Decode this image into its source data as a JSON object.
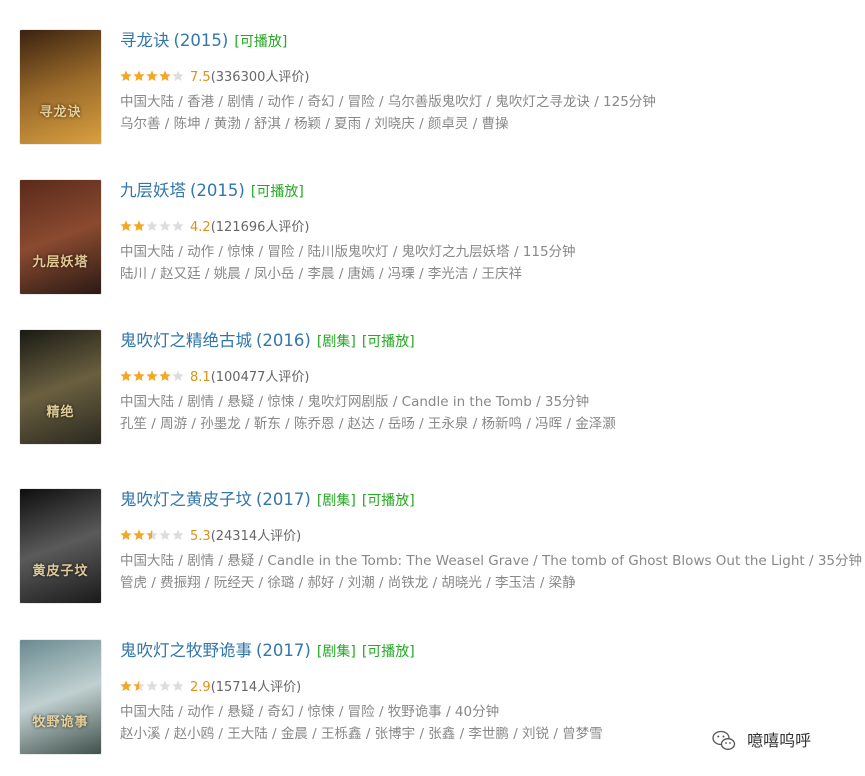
{
  "films": [
    {
      "title": "寻龙诀",
      "year": "(2015)",
      "tags": [
        "[可播放]"
      ],
      "rating_stars": 4,
      "rating": "7.5",
      "votes": "(336300人评价)",
      "meta1": "中国大陆 / 香港 / 剧情 / 动作 / 奇幻 / 冒险 / 乌尔善版鬼吹灯 / 鬼吹灯之寻龙诀 / 125分钟",
      "meta2": "乌尔善 / 陈坤 / 黄渤 / 舒淇 / 杨颖 / 夏雨 / 刘晓庆 / 颜卓灵 / 曹操",
      "poster_text": "寻龙诀",
      "poster_colors": [
        "#3a2210",
        "#9a6a2a",
        "#d9a040"
      ]
    },
    {
      "title": "九层妖塔",
      "year": "(2015)",
      "tags": [
        "[可播放]"
      ],
      "rating_stars": 2,
      "rating": "4.2",
      "votes": "(121696人评价)",
      "meta1": "中国大陆 / 动作 / 惊悚 / 冒险 / 陆川版鬼吹灯 / 鬼吹灯之九层妖塔 / 115分钟",
      "meta2": "陆川 / 赵又廷 / 姚晨 / 凤小岳 / 李晨 / 唐嫣 / 冯瑮 / 李光洁 / 王庆祥",
      "poster_text": "九层妖塔",
      "poster_colors": [
        "#5a2a1a",
        "#8a4a30",
        "#2a1a14"
      ]
    },
    {
      "title": "鬼吹灯之精绝古城",
      "year": "(2016)",
      "tags": [
        "[剧集]",
        "[可播放]"
      ],
      "rating_stars": 4,
      "rating": "8.1",
      "votes": "(100477人评价)",
      "meta1": "中国大陆 / 剧情 / 悬疑 / 惊悚 / 鬼吹灯网剧版 / Candle in the Tomb / 35分钟",
      "meta2": "孔笙 / 周游 / 孙墨龙 / 靳东 / 陈乔恩 / 赵达 / 岳旸 / 王永泉 / 杨新鸣 / 冯晖 / 金泽灏",
      "poster_text": "精绝",
      "poster_colors": [
        "#1a1a14",
        "#6a6040",
        "#2a2820"
      ]
    },
    {
      "title": "鬼吹灯之黄皮子坟",
      "year": "(2017)",
      "tags": [
        "[剧集]",
        "[可播放]"
      ],
      "rating_stars": 2.5,
      "rating": "5.3",
      "votes": "(24314人评价)",
      "meta1": "中国大陆 / 剧情 / 悬疑 / Candle in the Tomb: The Weasel Grave / The tomb of Ghost Blows Out the Light / 35分钟",
      "meta2": "管虎 / 费振翔 / 阮经天 / 徐璐 / 郝好 / 刘潮 / 尚铁龙 / 胡晓光 / 李玉洁 / 梁静",
      "poster_text": "黄皮子坟",
      "poster_colors": [
        "#0e0e0e",
        "#5a5a5a",
        "#1a1a1a"
      ]
    },
    {
      "title": "鬼吹灯之牧野诡事",
      "year": "(2017)",
      "tags": [
        "[剧集]",
        "[可播放]"
      ],
      "rating_stars": 1.5,
      "rating": "2.9",
      "votes": "(15714人评价)",
      "meta1": "中国大陆 / 动作 / 悬疑 / 奇幻 / 惊悚 / 冒险 / 牧野诡事 / 40分钟",
      "meta2": "赵小溪 / 赵小鸥 / 王大陆 / 金晨 / 王栎鑫 / 张博宇 / 张鑫 / 李世鹏 / 刘锐 / 曾梦雪",
      "poster_text": "牧野诡事",
      "poster_colors": [
        "#6a8a90",
        "#c0d0d0",
        "#40504a"
      ]
    }
  ],
  "watermark": {
    "text": "噫嘻呜呼",
    "icon": "wechat-icon"
  },
  "colors": {
    "link": "#3377aa",
    "playable": "#22aa22",
    "star": "#f5a623",
    "star_empty": "#dddddd",
    "score": "#e09015",
    "meta": "#888888"
  }
}
